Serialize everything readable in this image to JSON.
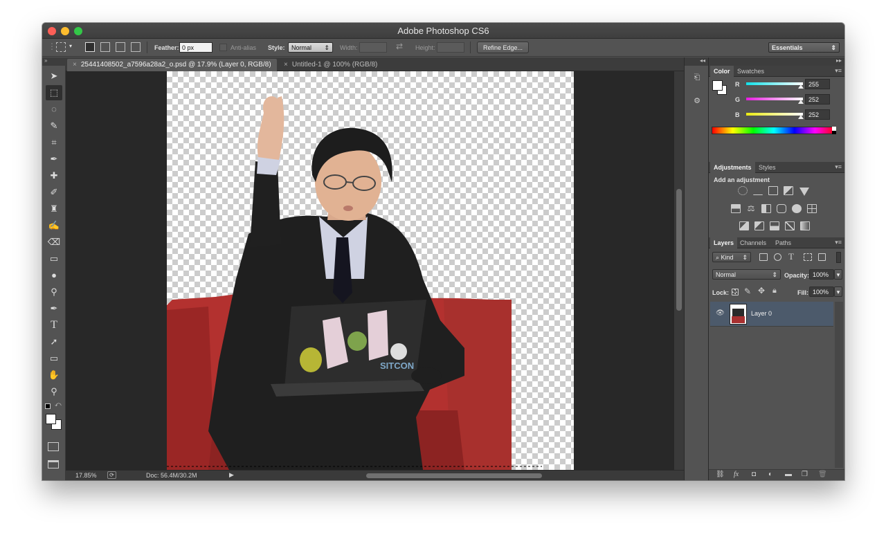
{
  "window": {
    "title": "Adobe Photoshop CS6",
    "traffic_lights": {
      "close": "#fc5f57",
      "minimize": "#fdbc2e",
      "zoom": "#33c748"
    }
  },
  "options": {
    "feather_label": "Feather:",
    "feather_value": "0 px",
    "antialias_label": "Anti-alias",
    "style_label": "Style:",
    "style_value": "Normal",
    "width_label": "Width:",
    "height_label": "Height:",
    "refine_edge": "Refine Edge...",
    "workspace": "Essentials"
  },
  "tools": [
    "move",
    "rectangular-marquee",
    "lasso",
    "quick-selection",
    "crop",
    "eyedropper",
    "spot-healing",
    "brush",
    "clone-stamp",
    "history-brush",
    "eraser",
    "gradient",
    "blur",
    "dodge",
    "pen",
    "type",
    "path-selection",
    "rectangle",
    "hand",
    "zoom"
  ],
  "tabs": [
    {
      "label": "25441408502_a7596a28a2_o.psd @ 17.9% (Layer 0, RGB/8)",
      "active": true
    },
    {
      "label": "Untitled-1 @ 100% (RGB/8)",
      "active": false
    }
  ],
  "status": {
    "zoom": "17.85%",
    "doc": "Doc: 56.4M/30.2M"
  },
  "color_panel": {
    "tabs": [
      "Color",
      "Swatches"
    ],
    "channels": [
      {
        "name": "R",
        "value": "255",
        "gradient": "#11e0e8"
      },
      {
        "name": "G",
        "value": "252",
        "gradient": "#e81ce0"
      },
      {
        "name": "B",
        "value": "252",
        "gradient": "#eaea12"
      }
    ]
  },
  "adjustments_panel": {
    "tabs": [
      "Adjustments",
      "Styles"
    ],
    "heading": "Add an adjustment"
  },
  "layers_panel": {
    "tabs": [
      "Layers",
      "Channels",
      "Paths"
    ],
    "filter": "Kind",
    "blend_mode": "Normal",
    "opacity_label": "Opacity:",
    "opacity_value": "100%",
    "lock_label": "Lock:",
    "fill_label": "Fill:",
    "fill_value": "100%",
    "layers": [
      {
        "name": "Layer 0",
        "visible": true
      }
    ]
  }
}
